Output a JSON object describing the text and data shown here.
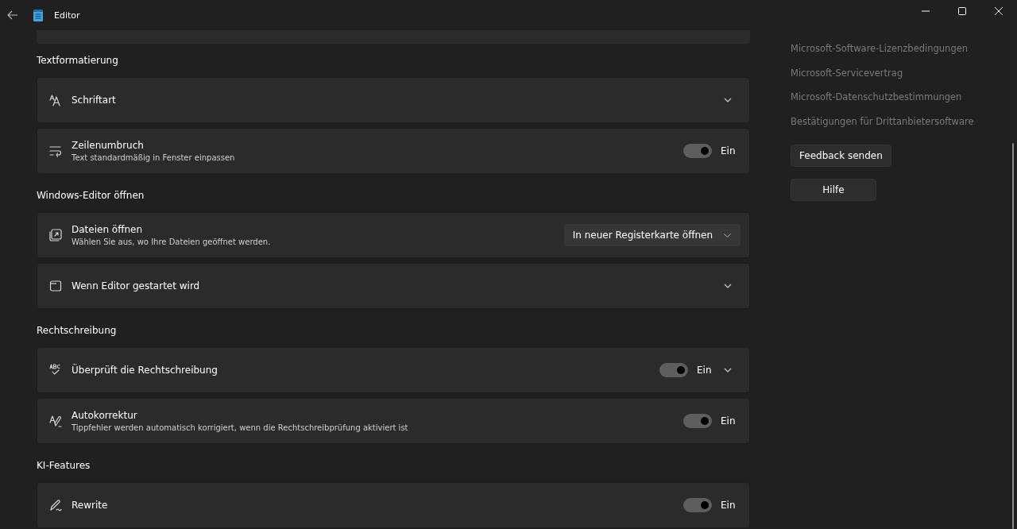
{
  "window": {
    "title": "Editor"
  },
  "sections": [
    {
      "heading": "Textformatierung",
      "rows": [
        {
          "kind": "expander",
          "title": "Schriftart"
        },
        {
          "kind": "toggle",
          "title": "Zeilenumbruch",
          "subtitle": "Text standardmäßig in Fenster einpassen",
          "on": true,
          "state_label": "Ein"
        }
      ]
    },
    {
      "heading": "Windows-Editor öffnen",
      "rows": [
        {
          "kind": "dropdown",
          "title": "Dateien öffnen",
          "subtitle": "Wählen Sie aus, wo Ihre Dateien geöffnet werden.",
          "value": "In neuer Registerkarte öffnen"
        },
        {
          "kind": "expander",
          "title": "Wenn Editor gestartet wird"
        }
      ]
    },
    {
      "heading": "Rechtschreibung",
      "rows": [
        {
          "kind": "toggle_expander",
          "title": "Überprüft die Rechtschreibung",
          "on": true,
          "state_label": "Ein"
        },
        {
          "kind": "toggle",
          "title": "Autokorrektur",
          "subtitle": "Tippfehler werden automatisch korrigiert, wenn die Rechtschreibprüfung aktiviert ist",
          "on": true,
          "state_label": "Ein"
        }
      ]
    },
    {
      "heading": "KI-Features",
      "rows": [
        {
          "kind": "toggle",
          "title": "Rewrite",
          "on": true,
          "state_label": "Ein"
        }
      ]
    }
  ],
  "links": [
    "Microsoft-Software-Lizenzbedingungen",
    "Microsoft-Servicevertrag",
    "Microsoft-Datenschutzbestimmungen",
    "Bestätigungen für Drittanbietersoftware"
  ],
  "buttons": [
    "Feedback senden",
    "Hilfe"
  ]
}
